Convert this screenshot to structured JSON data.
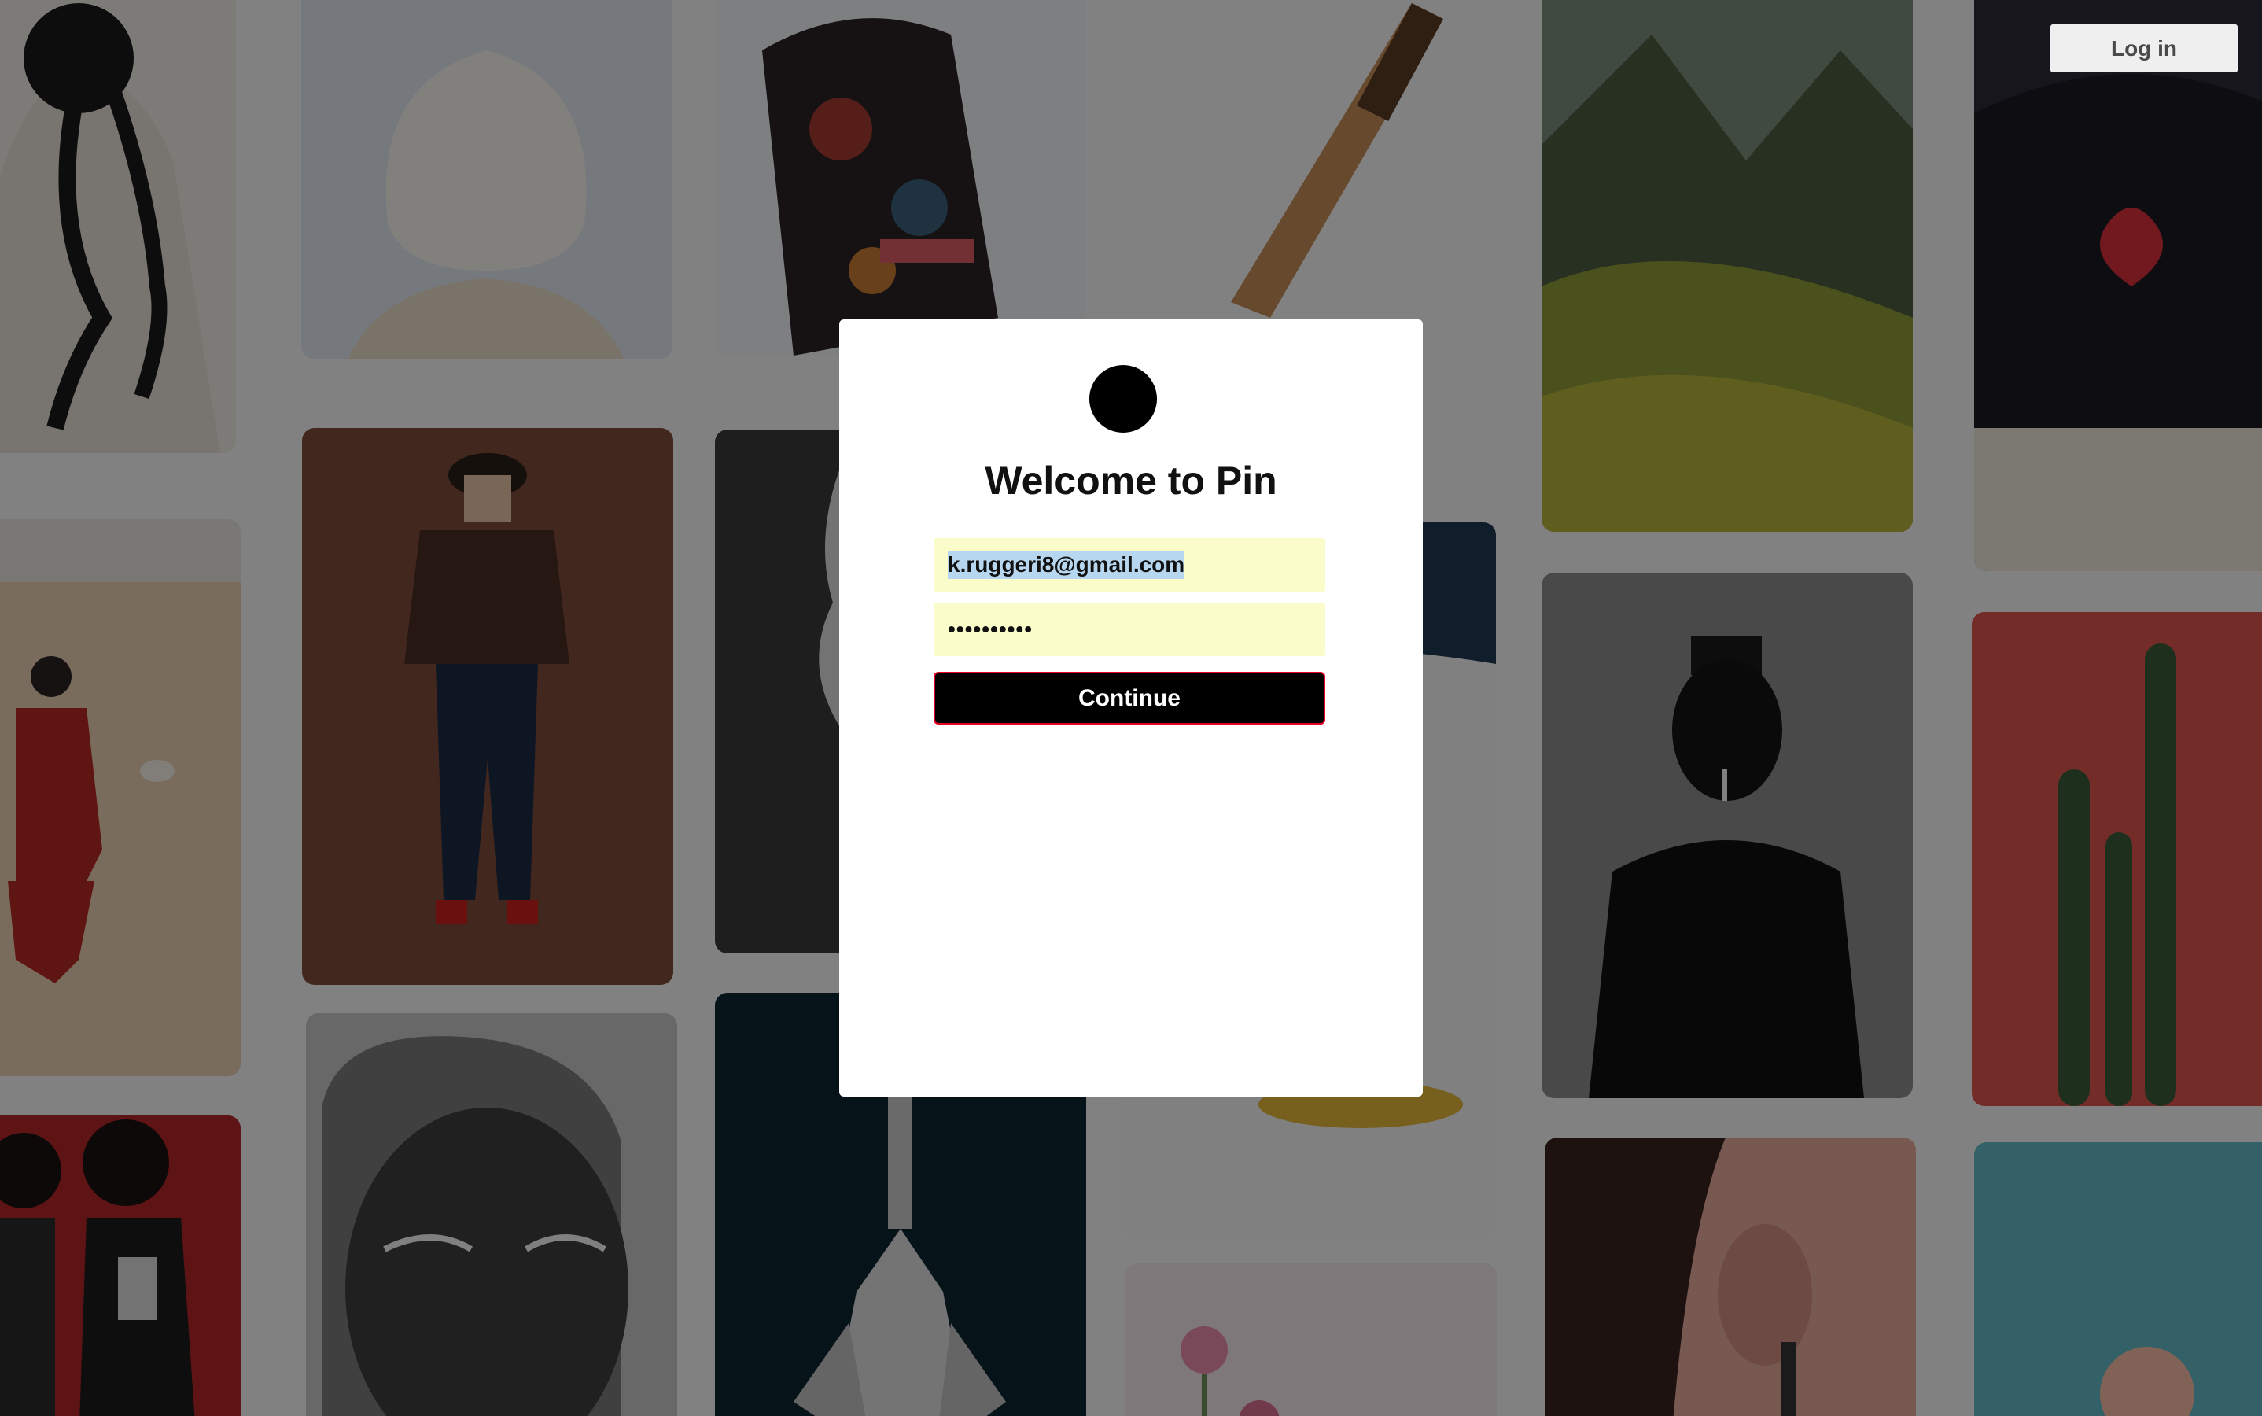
{
  "header": {
    "login_button_label": "Log in"
  },
  "modal": {
    "logo_icon": "pin-logo-icon",
    "title": "Welcome to Pin",
    "email_value": "k.ruggeri8@gmail.com",
    "password_value": "••••••••••",
    "continue_label": "Continue"
  },
  "background_pins": [
    {
      "name": "pin-braided-hair",
      "color": "#e9e4dc"
    },
    {
      "name": "pin-blonde-bob",
      "color": "#d9dfe6"
    },
    {
      "name": "pin-embroidered-jacket",
      "color": "#3a2a2a"
    },
    {
      "name": "pin-toast-loaf",
      "color": "#f2f2f2"
    },
    {
      "name": "pin-rice-terraces",
      "color": "#6f7a3a"
    },
    {
      "name": "pin-bowie-jacket",
      "color": "#2a2a35"
    },
    {
      "name": "pin-desert-woman",
      "color": "#e8d2b6"
    },
    {
      "name": "pin-sweater-jeans",
      "color": "#7a4a3a"
    },
    {
      "name": "pin-profile-bw",
      "color": "#cfcfcf"
    },
    {
      "name": "pin-blue-cap",
      "color": "#f1f1f1"
    },
    {
      "name": "pin-grace-jones",
      "color": "#6e6e6e"
    },
    {
      "name": "pin-cactus-red",
      "color": "#d8554c"
    },
    {
      "name": "pin-red-group",
      "color": "#b3252a"
    },
    {
      "name": "pin-beaded-eyes",
      "color": "#b9b9b9"
    },
    {
      "name": "pin-crystal",
      "color": "#0d2a33"
    },
    {
      "name": "pin-pink-flowers",
      "color": "#f2e3ea"
    },
    {
      "name": "pin-earring",
      "color": "#e0a394"
    },
    {
      "name": "pin-teal-flower",
      "color": "#63b6c4"
    }
  ],
  "colors": {
    "brand": "#e60023",
    "autofill": "#fafdc9",
    "overlay": "rgba(0,0,0,0.47)"
  }
}
